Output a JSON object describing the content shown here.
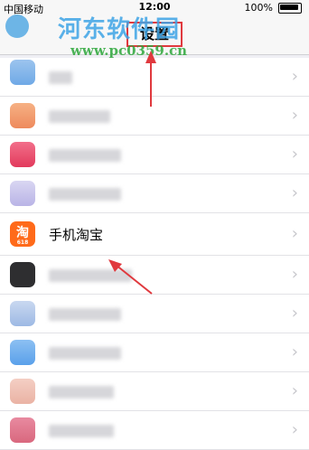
{
  "status": {
    "carrier": "中国移动",
    "time": "12:00",
    "battery": "100%"
  },
  "nav": {
    "title": "设置"
  },
  "watermark": {
    "name": "河东软件园",
    "url": "www.pc0359.cn"
  },
  "list": {
    "highlighted_label": "手机淘宝",
    "taobao_icon_char": "淘",
    "taobao_icon_sub": "618",
    "chevron": "›"
  },
  "colors": {
    "annotation": "#e0393e",
    "taobao": "#ff6a1a"
  }
}
